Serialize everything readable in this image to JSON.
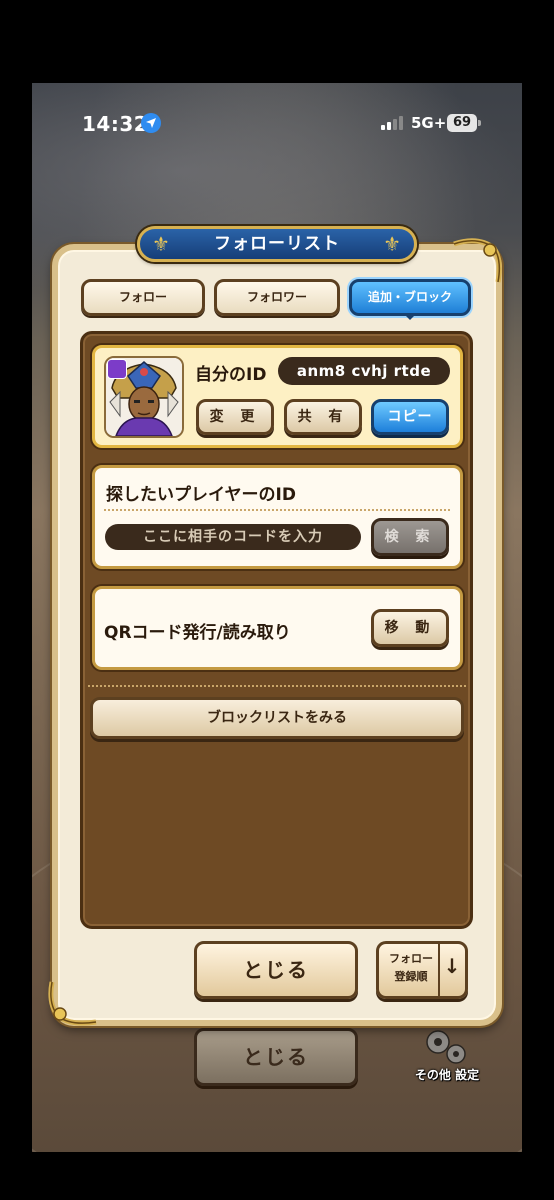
{
  "status_bar": {
    "time": "14:32",
    "network": "5G+",
    "battery": "69"
  },
  "dialog": {
    "title": "フォローリスト",
    "tabs": [
      {
        "label": "フォロー",
        "active": false
      },
      {
        "label": "フォロワー",
        "active": false
      },
      {
        "label": "追加・ブロック",
        "active": true
      }
    ],
    "my_id": {
      "label": "自分のID",
      "value": "anm8 cvhj rtde",
      "buttons": {
        "change": "変 更",
        "share": "共 有",
        "copy": "コピー"
      }
    },
    "search": {
      "label": "探したいプレイヤーのID",
      "placeholder": "ここに相手のコードを入力",
      "button": "検 索"
    },
    "qr": {
      "label": "QRコード発行/読み取り",
      "button": "移 動"
    },
    "block_list_button": "ブロックリストをみる",
    "close_button": "とじる",
    "sort_button": {
      "line1": "フォロー",
      "line2": "登録順",
      "arrow": "↓"
    }
  },
  "background": {
    "close_button": "とじる",
    "other_settings": "その他 設定"
  },
  "colors": {
    "accent_blue": "#1f7fd6",
    "frame_gold": "#d9c08a",
    "pane_brown": "#6e4a24"
  }
}
